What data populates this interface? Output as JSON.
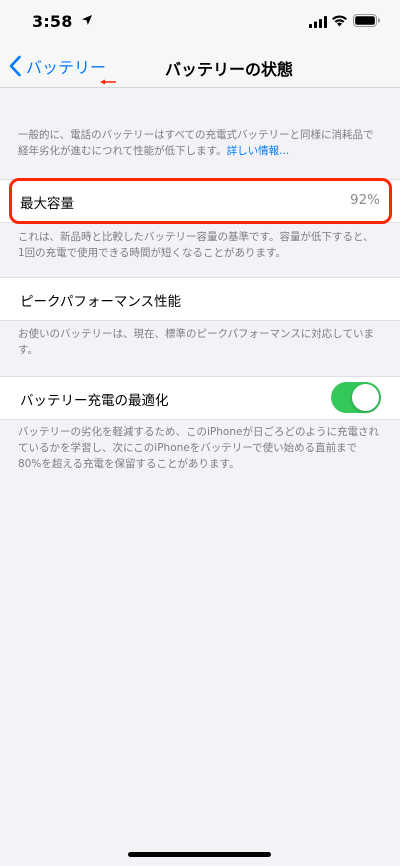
{
  "status_bar": {
    "time": "3:58",
    "icons": [
      "location-arrow-icon",
      "cellular-signal-icon",
      "wifi-icon",
      "battery-icon"
    ]
  },
  "nav": {
    "back_label": "バッテリー",
    "title": "バッテリーの状態"
  },
  "intro": {
    "text": "一般的に、電話のバッテリーはすべての充電式バッテリーと同様に消耗品で経年劣化が進むにつれて性能が低下します。",
    "link_label": "詳しい情報..."
  },
  "max_capacity": {
    "label": "最大容量",
    "value": "92%",
    "note": "これは、新品時と比較したバッテリー容量の基準です。容量が低下すると、1回の充電で使用できる時間が短くなることがあります。"
  },
  "peak_performance": {
    "label": "ピークパフォーマンス性能",
    "note": "お使いのバッテリーは、現在、標準のピークパフォーマンスに対応しています。"
  },
  "optimized_charging": {
    "label": "バッテリー充電の最適化",
    "enabled": true,
    "note": "バッテリーの劣化を軽減するため、このiPhoneが日ごろどのように充電されているかを学習し、次にこのiPhoneをバッテリーで使い始める直前まで80%を超える充電を保留することがあります。"
  },
  "colors": {
    "accent": "#007aff",
    "toggle_on": "#34c759",
    "highlight": "#ff2600",
    "background": "#f2f2f7"
  }
}
